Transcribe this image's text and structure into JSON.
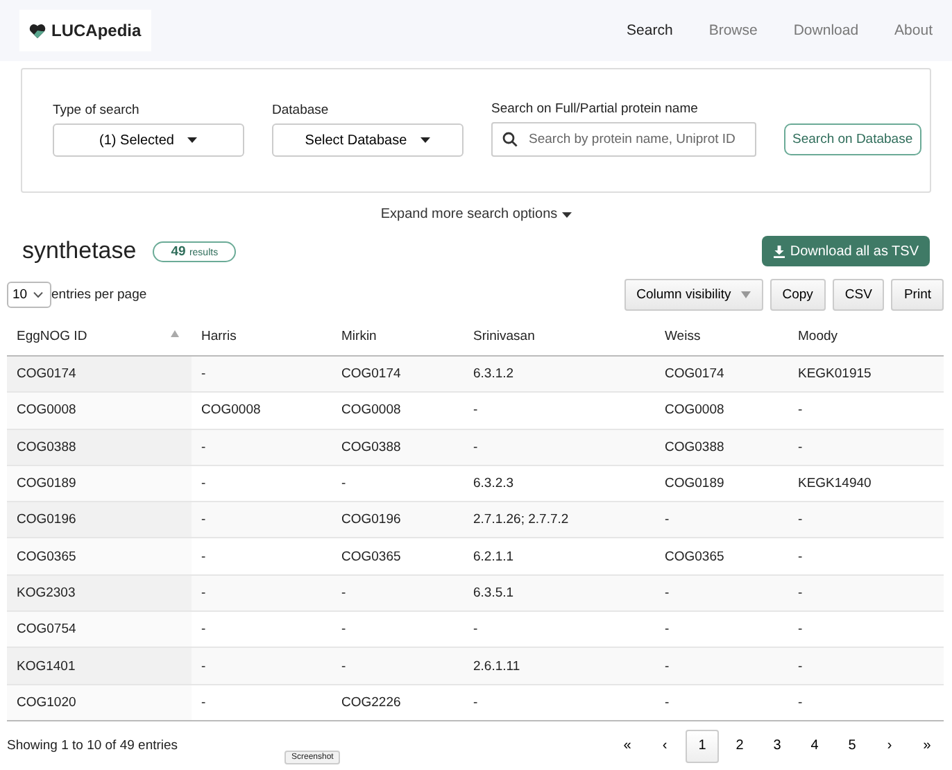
{
  "brand": {
    "name": "LUCApedia"
  },
  "nav": [
    {
      "label": "Search",
      "selected": true
    },
    {
      "label": "Browse",
      "selected": false
    },
    {
      "label": "Download",
      "selected": false
    },
    {
      "label": "About",
      "selected": false
    }
  ],
  "search_form": {
    "fields": [
      {
        "kind": "dropdown",
        "label": "Type of search",
        "value": "(1) Selected"
      },
      {
        "kind": "dropdown",
        "label": "Database",
        "value": "Select Database"
      },
      {
        "kind": "search",
        "label": "Search on Full/Partial protein name",
        "placeholder": "Search by protein name, Uniprot ID"
      }
    ],
    "submit": "Search on Database",
    "expand": "Expand more search options"
  },
  "results": {
    "query": "synthetase",
    "count": "49",
    "count_label": "results",
    "download": "Download all as TSV"
  },
  "table_controls": {
    "page_size": "10",
    "page_size_label": "entries per page",
    "buttons": [
      "Column visibility",
      "Copy",
      "CSV",
      "Print"
    ]
  },
  "table": {
    "columns": [
      "EggNOG ID",
      "Harris",
      "Mirkin",
      "Srinivasan",
      "Weiss",
      "Moody"
    ],
    "rows": [
      [
        "COG0174",
        "-",
        "COG0174",
        "6.3.1.2",
        "COG0174",
        "KEGK01915"
      ],
      [
        "COG0008",
        "COG0008",
        "COG0008",
        "-",
        "COG0008",
        "-"
      ],
      [
        "COG0388",
        "-",
        "COG0388",
        "-",
        "COG0388",
        "-"
      ],
      [
        "COG0189",
        "-",
        "-",
        "6.3.2.3",
        "COG0189",
        "KEGK14940"
      ],
      [
        "COG0196",
        "-",
        "COG0196",
        "2.7.1.26; 2.7.7.2",
        "-",
        "-"
      ],
      [
        "COG0365",
        "-",
        "COG0365",
        "6.2.1.1",
        "COG0365",
        "-"
      ],
      [
        "KOG2303",
        "-",
        "-",
        "6.3.5.1",
        "-",
        "-"
      ],
      [
        "COG0754",
        "-",
        "-",
        "-",
        "-",
        "-"
      ],
      [
        "KOG1401",
        "-",
        "-",
        "2.6.1.11",
        "-",
        "-"
      ],
      [
        "COG1020",
        "-",
        "COG2226",
        "-",
        "-",
        "-"
      ]
    ]
  },
  "footer": {
    "info": "Showing 1 to 10 of 49 entries",
    "tooltip": "Screenshot",
    "pages": [
      {
        "label": "«",
        "selected": false
      },
      {
        "label": "‹",
        "selected": false
      },
      {
        "label": "1",
        "selected": true
      },
      {
        "label": "2",
        "selected": false
      },
      {
        "label": "3",
        "selected": false
      },
      {
        "label": "4",
        "selected": false
      },
      {
        "label": "5",
        "selected": false
      },
      {
        "label": "›",
        "selected": false
      },
      {
        "label": "»",
        "selected": false
      }
    ]
  }
}
